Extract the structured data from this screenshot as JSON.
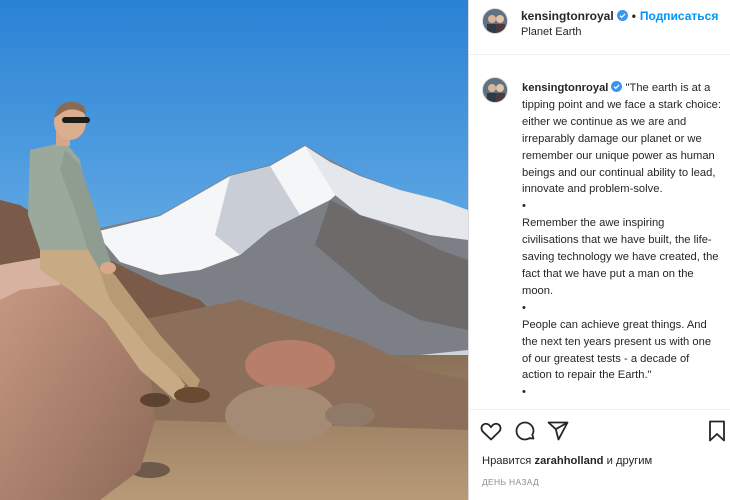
{
  "post": {
    "username": "kensingtonroyal",
    "separator": "•",
    "follow_label": "Подписаться",
    "location": "Planet Earth"
  },
  "caption": {
    "username": "kensingtonroyal",
    "p1": "\"The earth is at a tipping point and we face a stark choice: either we continue as we are and irreparably damage our planet or we remember our unique power as human beings and our continual ability to lead, innovate and problem-solve.",
    "bullet1": "•",
    "p2": "Remember the awe inspiring civilisations that we have built, the life-saving technology we have created, the fact that we have put a man on the moon.",
    "bullet2": "•",
    "p3": "People can achieve great things. And the next ten years present us with one of our greatest tests - a decade of action to repair the Earth.\"",
    "bullet3": "•"
  },
  "likes": {
    "prefix": "Нравится",
    "user": "zarahholland",
    "suffix": "и другим"
  },
  "timestamp": "День назад",
  "icons": {
    "verified": "verified-badge-icon",
    "like": "heart-outline-icon",
    "comment": "comment-bubble-icon",
    "share": "paper-plane-icon",
    "save": "bookmark-icon"
  },
  "colors": {
    "verified": "#3897f0",
    "follow": "#0095f6",
    "text": "#262626",
    "muted": "#8e8e8e",
    "sky_top": "#2f86d6",
    "sky_bottom": "#8cc4ee"
  }
}
